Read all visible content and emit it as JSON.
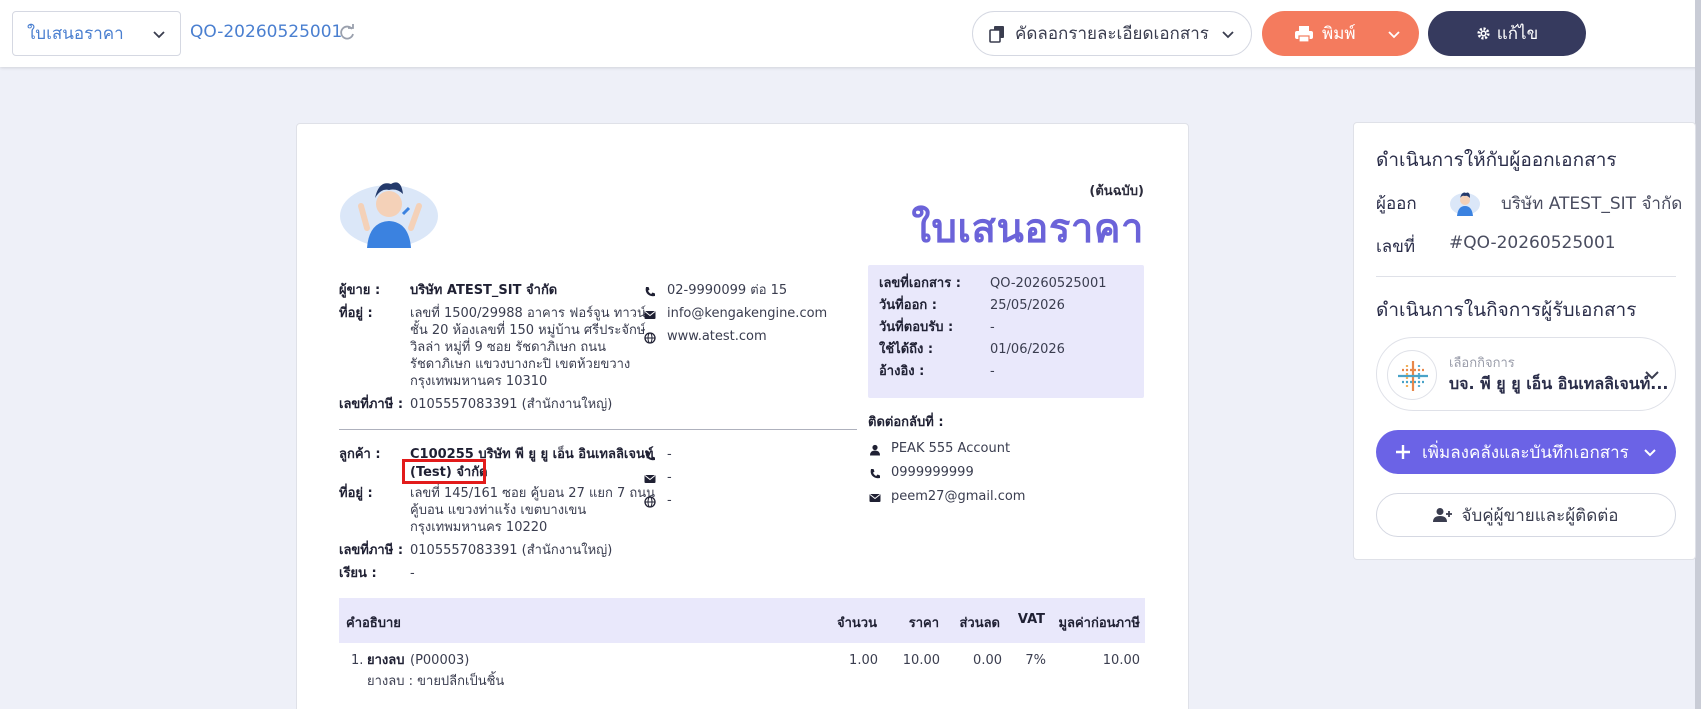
{
  "topbar": {
    "doc_type": "ใบเสนอราคา",
    "doc_number": "QO-20260525001",
    "copy_label": "คัดลอกรายละเอียดเอกสาร",
    "print_label": "พิมพ์",
    "edit_label": "แก้ไข"
  },
  "document": {
    "copy_type": "(ต้นฉบับ)",
    "title": "ใบเสนอราคา",
    "seller": {
      "label": "ผู้ขาย :",
      "name": "บริษัท ATEST_SIT จำกัด",
      "address_label": "ที่อยู่ :",
      "address_lines": [
        "เลขที่ 1500/29988 อาคาร ฟอร์จูน ทาวน์",
        "ชั้น 20 ห้องเลขที่ 150 หมู่บ้าน ศรีประจักษ์",
        "วิลล่า หมู่ที่ 9 ซอย รัชดาภิเษก ถนน",
        "รัชดาภิเษก แขวงบางกะปิ เขตห้วยขวาง",
        "กรุงเทพมหานคร 10310"
      ],
      "tax_label": "เลขที่ภาษี :",
      "tax_id": "0105557083391 (สำนักงานใหญ่)",
      "phone": "02-9990099 ต่อ 15",
      "email": "info@kengakengine.com",
      "website": "www.atest.com"
    },
    "info": {
      "doc_no_label": "เลขที่เอกสาร :",
      "doc_no": "QO-20260525001",
      "issue_label": "วันที่ออก :",
      "issue_date": "25/05/2026",
      "reply_label": "วันที่ตอบรับ :",
      "reply_date": "-",
      "valid_label": "ใช้ได้ถึง :",
      "valid_date": "01/06/2026",
      "ref_label": "อ้างอิง :",
      "ref": "-"
    },
    "contact": {
      "label": "ติดต่อกลับที่ :",
      "name": "PEAK 555 Account",
      "phone": "0999999999",
      "email": "peem27@gmail.com"
    },
    "customer": {
      "label": "ลูกค้า :",
      "name_line1": "C100255 บริษัท พี ยู ยู เอ็น อินเทลลิเจนท์",
      "name_line2": "(Test) จำกัด",
      "address_label": "ที่อยู่ :",
      "address_lines": [
        "เลขที่ 145/161 ซอย คู้บอน 27 แยก 7 ถนน",
        "คู้บอน  แขวงท่าแร้ง เขตบางเขน",
        "กรุงเทพมหานคร 10220"
      ],
      "tax_label": "เลขที่ภาษี :",
      "tax_id": "0105557083391 (สำนักงานใหญ่)",
      "attn_label": "เรียน :",
      "attn": "-",
      "phone": "-",
      "email": "-",
      "website": "-"
    },
    "table": {
      "headers": [
        "คำอธิบาย",
        "จำนวน",
        "ราคา",
        "ส่วนลด",
        "VAT",
        "มูลค่าก่อนภาษี"
      ],
      "rows": [
        {
          "no": "1.",
          "name": "ยางลบ",
          "code": "(P00003)",
          "desc": "ยางลบ : ขายปลีกเป็นชิ้น",
          "qty": "1.00",
          "price": "10.00",
          "discount": "0.00",
          "vat": "7%",
          "amount": "10.00"
        }
      ]
    }
  },
  "panel": {
    "issuer_title": "ดำเนินการให้กับผู้ออกเอกสาร",
    "issuer_label": "ผู้ออก",
    "issuer_name": "บริษัท ATEST_SIT จำกัด",
    "number_label": "เลขที่",
    "number_value": "#QO-20260525001",
    "recipient_title": "ดำเนินการในกิจการผู้รับเอกสาร",
    "business_hint": "เลือกกิจการ",
    "business_name": "บจ. พี ยู ยู เอ็น อินเทลลิเจนท์...",
    "save_label": "เพิ่มลงคลังและบันทึกเอกสาร",
    "pair_label": "จับคู่ผู้ขายและผู้ติดต่อ"
  },
  "colors": {
    "accent": "#6b63e6",
    "title": "#6b63d9",
    "print": "#f47b5e",
    "edit": "#363a5e",
    "link": "#4a7fd0",
    "highlight": "#e21b1b"
  }
}
